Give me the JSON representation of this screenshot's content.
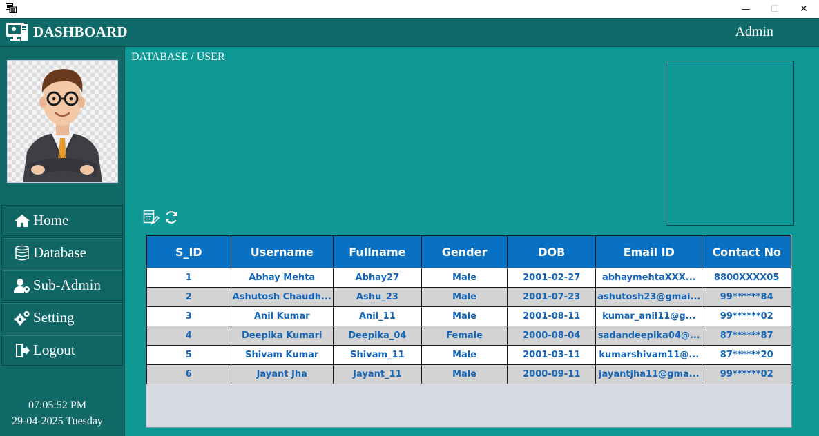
{
  "window": {
    "minimize_glyph": "—",
    "maximize_glyph": "☐",
    "close_glyph": "✕"
  },
  "header": {
    "title": "DASHBOARD",
    "user": "Admin"
  },
  "sidebar": {
    "items": [
      {
        "label": "Home",
        "icon": "home-icon"
      },
      {
        "label": "Database",
        "icon": "database-icon"
      },
      {
        "label": "Sub-Admin",
        "icon": "user-gear-icon"
      },
      {
        "label": "Setting",
        "icon": "gear-icon"
      },
      {
        "label": "Logout",
        "icon": "logout-icon"
      }
    ],
    "clock": {
      "time": "07:05:52 PM",
      "date": "29-04-2025 Tuesday"
    }
  },
  "main": {
    "breadcrumb": "DATABASE / USER"
  },
  "table": {
    "columns": [
      "S_ID",
      "Username",
      "Fullname",
      "Gender",
      "DOB",
      "Email ID",
      "Contact No"
    ],
    "rows": [
      [
        "1",
        "Abhay Mehta",
        "Abhay27",
        "Male",
        "2001-02-27",
        "abhaymehtaXXX...",
        "8800XXXX05"
      ],
      [
        "2",
        "Ashutosh Chaudh...",
        "Ashu_23",
        "Male",
        "2001-07-23",
        "ashutosh23@gmai...",
        "99******84"
      ],
      [
        "3",
        "Anil Kumar",
        "Anil_11",
        "Male",
        "2001-08-11",
        "kumar_anil11@g...",
        "99******02"
      ],
      [
        "4",
        "Deepika Kumari",
        "Deepika_04",
        "Female",
        "2000-08-04",
        "sadandeepika04@...",
        "87******87"
      ],
      [
        "5",
        "Shivam Kumar",
        "Shivam_11",
        "Male",
        "2001-03-11",
        "kumarshivam11@...",
        "87******20"
      ],
      [
        "6",
        "Jayant Jha",
        "Jayant_11",
        "Male",
        "2000-09-11",
        "jayantjha11@gma...",
        "99******02"
      ]
    ]
  },
  "colors": {
    "header_bg": "#106a69",
    "sidebar_bg": "#116968",
    "main_bg": "#0e9896",
    "table_header_bg": "#0871c4",
    "cell_text": "#1565b8"
  }
}
